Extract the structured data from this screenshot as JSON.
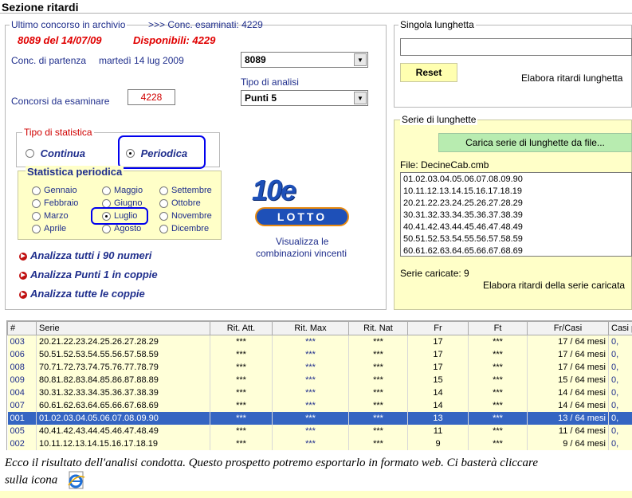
{
  "header": {
    "title": "Sezione ritardi"
  },
  "left": {
    "last_label": "Ultimo concorso in archivio",
    "examined_label": ">>> Conc. esaminati: 4229",
    "last_value": "8089 del 14/07/09",
    "available": "Disponibili: 4229",
    "start_label": "Conc. di partenza",
    "start_date": "martedì 14 lug 2009",
    "start_combo": "8089",
    "analysis_label": "Tipo di analisi",
    "analysis_combo": "Punti 5",
    "to_examine_label": "Concorsi da esaminare",
    "to_examine_value": "4228"
  },
  "stat_type": {
    "legend": "Tipo di statistica",
    "continua": "Continua",
    "periodica": "Periodica"
  },
  "periodic": {
    "legend": "Statistica periodica",
    "months": [
      "Gennaio",
      "Febbraio",
      "Marzo",
      "Aprile",
      "Maggio",
      "Giugno",
      "Luglio",
      "Agosto",
      "Settembre",
      "Ottobre",
      "Novembre",
      "Dicembre"
    ],
    "selected": "Luglio"
  },
  "logo": {
    "brand_top": "10e",
    "brand_bottom": "LOTTO",
    "caption1": "Visualizza le",
    "caption2": "combinazioni vincenti"
  },
  "links": [
    "Analizza tutti i 90 numeri",
    "Analizza Punti 1 in coppie",
    "Analizza tutte le coppie"
  ],
  "right": {
    "single_legend": "Singola lunghetta",
    "reset": "Reset",
    "elab_single": "Elabora ritardi lunghetta",
    "series_legend": "Serie di lunghette",
    "load_btn": "Carica serie di lunghette da file...",
    "file": "File: DecineCab.cmb",
    "series": [
      "01.02.03.04.05.06.07.08.09.90",
      "10.11.12.13.14.15.16.17.18.19",
      "20.21.22.23.24.25.26.27.28.29",
      "30.31.32.33.34.35.36.37.38.39",
      "40.41.42.43.44.45.46.47.48.49",
      "50.51.52.53.54.55.56.57.58.59",
      "60.61.62.63.64.65.66.67.68.69"
    ],
    "loaded": "Serie caricate: 9",
    "elab_series": "Elabora ritardi della serie caricata"
  },
  "table": {
    "headers": [
      "#",
      "Serie",
      "Rit. Att.",
      "Rit. Max",
      "Rit. Nat",
      "Fr",
      "Ft",
      "Fr/Casi",
      "Casi p"
    ],
    "rows": [
      [
        "003",
        "20.21.22.23.24.25.26.27.28.29",
        "***",
        "***",
        "***",
        "17",
        "***",
        "17 / 64 mesi",
        "0,"
      ],
      [
        "006",
        "50.51.52.53.54.55.56.57.58.59",
        "***",
        "***",
        "***",
        "17",
        "***",
        "17 / 64 mesi",
        "0,"
      ],
      [
        "008",
        "70.71.72.73.74.75.76.77.78.79",
        "***",
        "***",
        "***",
        "17",
        "***",
        "17 / 64 mesi",
        "0,"
      ],
      [
        "009",
        "80.81.82.83.84.85.86.87.88.89",
        "***",
        "***",
        "***",
        "15",
        "***",
        "15 / 64 mesi",
        "0,"
      ],
      [
        "004",
        "30.31.32.33.34.35.36.37.38.39",
        "***",
        "***",
        "***",
        "14",
        "***",
        "14 / 64 mesi",
        "0,"
      ],
      [
        "007",
        "60.61.62.63.64.65.66.67.68.69",
        "***",
        "***",
        "***",
        "14",
        "***",
        "14 / 64 mesi",
        "0,"
      ],
      [
        "001",
        "01.02.03.04.05.06.07.08.09.90",
        "***",
        "***",
        "***",
        "13",
        "***",
        "13 / 64 mesi",
        "0,"
      ],
      [
        "005",
        "40.41.42.43.44.45.46.47.48.49",
        "***",
        "***",
        "***",
        "11",
        "***",
        "11 / 64 mesi",
        "0,"
      ],
      [
        "002",
        "10.11.12.13.14.15.16.17.18.19",
        "***",
        "***",
        "***",
        "9",
        "***",
        "9 / 64 mesi",
        "0,"
      ]
    ],
    "selected_index": 6
  },
  "footer": {
    "line1": "Ecco il risultato dell'analisi condotta. Questo prospetto potremo esportarlo in formato web. Ci basterà cliccare",
    "line2": "sulla icona"
  },
  "colors": {
    "accent": "#1f2e8c",
    "red": "#e00000",
    "highlight_border": "#0000ee",
    "selected_row": "#3565c2",
    "panel_yellow": "#ffffc8"
  }
}
